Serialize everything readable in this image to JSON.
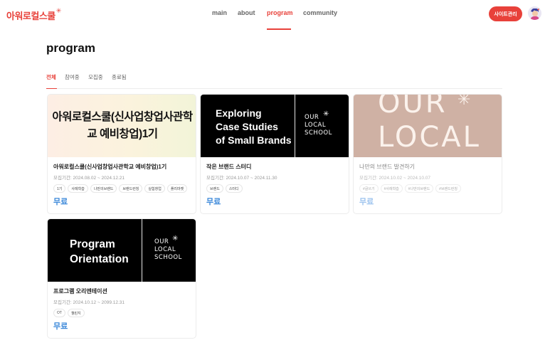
{
  "header": {
    "logo_text": "아워로컬스쿨",
    "logo_star": "✳",
    "nav": [
      "main",
      "about",
      "program",
      "community"
    ],
    "active_nav": "program",
    "admin_button": "사이트관리"
  },
  "page": {
    "title": "program",
    "tabs": [
      "전체",
      "참여중",
      "모집중",
      "종료됨"
    ],
    "active_tab": "전체"
  },
  "cards": [
    {
      "thumb_text": "아워로컬스쿨(신사업창업사관학교 예비창업)1기",
      "title": "아워로컬스쿨(신사업창업사관학교 예비창업)1기",
      "period": "모집기간: 2024.08.02 ~ 2024.12.21",
      "tags": [
        "1기",
        "사례학습",
        "나만의브랜드",
        "브랜드런칭",
        "실험창업",
        "플리마켓"
      ],
      "price": "무료"
    },
    {
      "thumb_text": "Exploring\nCase Studies\nof Small Brands",
      "thumb_logo": "OUR\nLOCAL\nSCHOOL",
      "thumb_star": "✳",
      "title": "작은 브랜드 스터디",
      "period": "모집기간: 2024.10.07 ~ 2024.11.30",
      "tags": [
        "브랜드",
        "스터디"
      ],
      "price": "무료"
    },
    {
      "thumb_text": "OUR\nLOCAL",
      "thumb_star": "✳",
      "title": "나만의 브랜드 발견하기",
      "period": "모집기간: 2024.10.02 ~ 2024.10.07",
      "tags": [
        "#글쓰기",
        "#사례학습",
        "#나만의브랜드",
        "#브랜드런칭"
      ],
      "price": "무료"
    },
    {
      "thumb_text": "Program\nOrientation",
      "thumb_logo": "OUR\nLOCAL\nSCHOOL",
      "thumb_star": "✳",
      "title": "프로그램 오리엔테이션",
      "period": "모집기간: 2024.10.12 ~ 2099.12.31",
      "tags": [
        "OT",
        "챌린지"
      ],
      "price": "무료"
    }
  ],
  "colors": {
    "accent": "#e8413a",
    "price": "#3a87d9"
  }
}
